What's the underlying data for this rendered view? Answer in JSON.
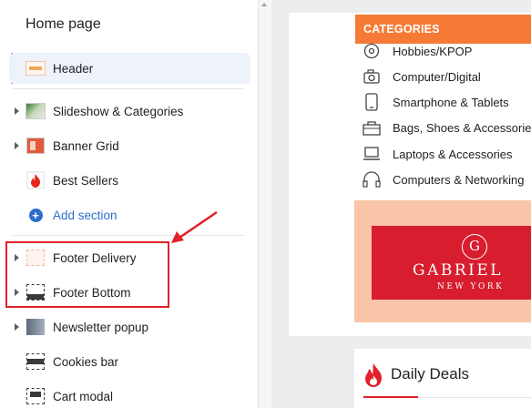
{
  "sidebar": {
    "title": "Home page",
    "items": [
      {
        "label": "Header",
        "icon": "header-thumbnail-icon",
        "selected": true
      },
      {
        "label": "Slideshow & Categories",
        "icon": "slideshow-thumbnail-icon"
      },
      {
        "label": "Banner Grid",
        "icon": "banner-grid-thumbnail-icon"
      },
      {
        "label": "Best Sellers",
        "icon": "fire-thumbnail-icon"
      },
      {
        "label": "Add section",
        "icon": "plus-circle-icon"
      },
      {
        "label": "Footer Delivery",
        "icon": "footer-delivery-thumbnail-icon"
      },
      {
        "label": "Footer Bottom",
        "icon": "footer-bottom-thumbnail-icon"
      },
      {
        "label": "Newsletter popup",
        "icon": "newsletter-thumbnail-icon"
      },
      {
        "label": "Cookies bar",
        "icon": "cookies-bar-thumbnail-icon"
      },
      {
        "label": "Cart modal",
        "icon": "cart-modal-thumbnail-icon"
      }
    ]
  },
  "preview": {
    "categories_header": "CATEGORIES",
    "categories": [
      {
        "label": "Hobbies/KPOP",
        "icon": "vinyl-icon"
      },
      {
        "label": "Computer/Digital",
        "icon": "camera-icon"
      },
      {
        "label": "Smartphone & Tablets",
        "icon": "smartphone-icon"
      },
      {
        "label": "Bags, Shoes & Accessories",
        "icon": "bag-icon"
      },
      {
        "label": "Laptops & Accessories",
        "icon": "laptop-icon"
      },
      {
        "label": "Computers & Networking",
        "icon": "headphones-icon"
      }
    ],
    "promo": {
      "brand": "GABRIEL",
      "sub": "NEW YORK",
      "logo": "G"
    },
    "deals_title": "Daily Deals"
  },
  "colors": {
    "accent": "#2c6ecb",
    "highlight": "#e0212a",
    "categories_bar": "#f57a36",
    "promo_bg": "#f9c4a8",
    "promo_brand": "#d71d2e"
  }
}
